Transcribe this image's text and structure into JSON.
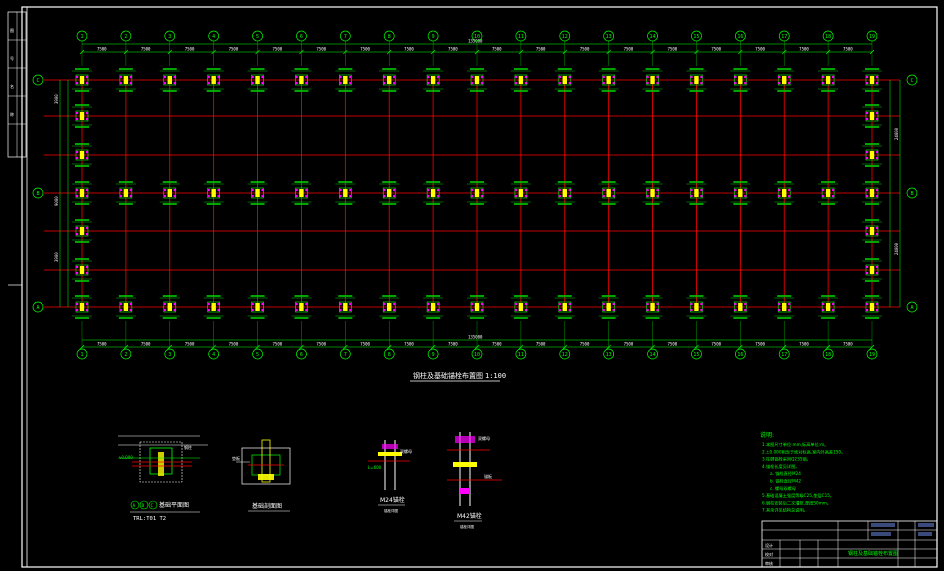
{
  "plan": {
    "title": "钢柱及基础锚栓布置图",
    "scale": "1:100",
    "total_length": "135000",
    "bay_dim": "7500",
    "row_labels": [
      "C",
      "B",
      "A"
    ],
    "col_labels": [
      "1",
      "2",
      "3",
      "4",
      "5",
      "6",
      "7",
      "8",
      "9",
      "10",
      "11",
      "12",
      "13",
      "14",
      "15",
      "16",
      "17",
      "18",
      "19"
    ],
    "left_dims": [
      "3900",
      "9000",
      "3900"
    ],
    "right_dims": [
      "24000",
      "24000"
    ]
  },
  "details": {
    "detail1_tag": "A B C",
    "detail1_title": "基础平面图",
    "detail1_sub": "TRL:T01 T2",
    "detail2_title": "基础剖面图",
    "detail3_title": "M24锚栓",
    "detail4_title": "M42锚栓"
  },
  "notes": {
    "heading": "说明:",
    "lines": [
      "1.本图尺寸单位:mm,标高单位:m。",
      "2.±0.000相当于绝对标高,室内外高差150。",
      "3.柱脚锚栓采用Q235钢。",
      "4.锚栓长度见详图。",
      "a. 锚栓直径M24",
      "b. 锚栓直径M42",
      "c. 螺母双螺母",
      "5.基础混凝土强度等级C25,垫层C15。",
      "6.钢柱安装后二次灌浆,厚度50mm。",
      "7.其余详见结构总说明。"
    ]
  },
  "title_block": {
    "drawing_name": "钢柱及基础锚栓布置图",
    "rows": [
      "设计",
      "校对",
      "审核"
    ]
  },
  "sidebar": {
    "labels": [
      "图",
      "号",
      "名",
      "称"
    ]
  }
}
